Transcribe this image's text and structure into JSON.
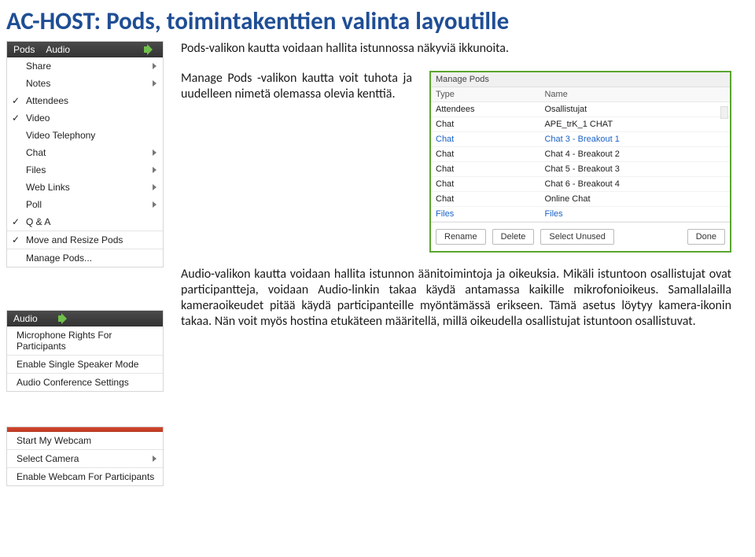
{
  "title": "AC-HOST: Pods, toimintakenttien valinta layoutille",
  "paragraphs": {
    "p1": "Pods-valikon kautta voidaan hallita istunnossa näkyviä ikkunoita.",
    "p2": "Manage Pods -valikon kautta voit tuhota ja uudelleen nimetä olemassa olevia kenttiä.",
    "p3": "Audio-valikon kautta voidaan hallita istunnon äänitoimintoja ja oikeuksia. Mikäli istuntoon osallistujat ovat participantteja, voidaan Audio-linkin takaa käydä antamassa kaikille mikrofonioikeus. Samallalailla kameraoikeudet pitää käydä participanteille myöntämässä erikseen. Tämä asetus löytyy kamera-ikonin takaa. Nän voit  myös hostina etukäteen määritellä, millä oikeudella osallistujat istuntoon osallistuvat."
  },
  "pods_menu": {
    "header_items": [
      "Pods",
      "Audio"
    ],
    "items": [
      {
        "label": "Share",
        "sub": true,
        "check": false
      },
      {
        "label": "Notes",
        "sub": true,
        "check": false
      },
      {
        "label": "Attendees",
        "sub": false,
        "check": true
      },
      {
        "label": "Video",
        "sub": false,
        "check": true
      },
      {
        "label": "Video Telephony",
        "sub": false,
        "check": false
      },
      {
        "label": "Chat",
        "sub": true,
        "check": false
      },
      {
        "label": "Files",
        "sub": true,
        "check": false
      },
      {
        "label": "Web Links",
        "sub": true,
        "check": false
      },
      {
        "label": "Poll",
        "sub": true,
        "check": false
      },
      {
        "label": "Q & A",
        "sub": false,
        "check": true
      }
    ],
    "move": "Move and Resize Pods",
    "manage": "Manage Pods..."
  },
  "audio_menu": {
    "header": "Audio",
    "items": [
      "Microphone Rights For Participants",
      "Enable Single Speaker Mode",
      "Audio Conference Settings"
    ]
  },
  "webcam_menu": {
    "items": [
      "Start My Webcam",
      "Select Camera",
      "Enable Webcam For Participants"
    ]
  },
  "manage_dialog": {
    "title": "Manage Pods",
    "cols": [
      "Type",
      "Name"
    ],
    "rows": [
      {
        "type": "Attendees",
        "name": "Osallistujat",
        "sel": false
      },
      {
        "type": "Chat",
        "name": "APE_trK_1 CHAT",
        "sel": false
      },
      {
        "type": "Chat",
        "name": "Chat 3 - Breakout 1",
        "sel": true
      },
      {
        "type": "Chat",
        "name": "Chat 4 - Breakout 2",
        "sel": false
      },
      {
        "type": "Chat",
        "name": "Chat 5 - Breakout 3",
        "sel": false
      },
      {
        "type": "Chat",
        "name": "Chat 6 - Breakout 4",
        "sel": false
      },
      {
        "type": "Chat",
        "name": "Online Chat",
        "sel": false
      }
    ],
    "footer": {
      "type": "Files",
      "name": "Files"
    },
    "buttons": {
      "rename": "Rename",
      "delete": "Delete",
      "select_unused": "Select Unused",
      "done": "Done"
    }
  }
}
